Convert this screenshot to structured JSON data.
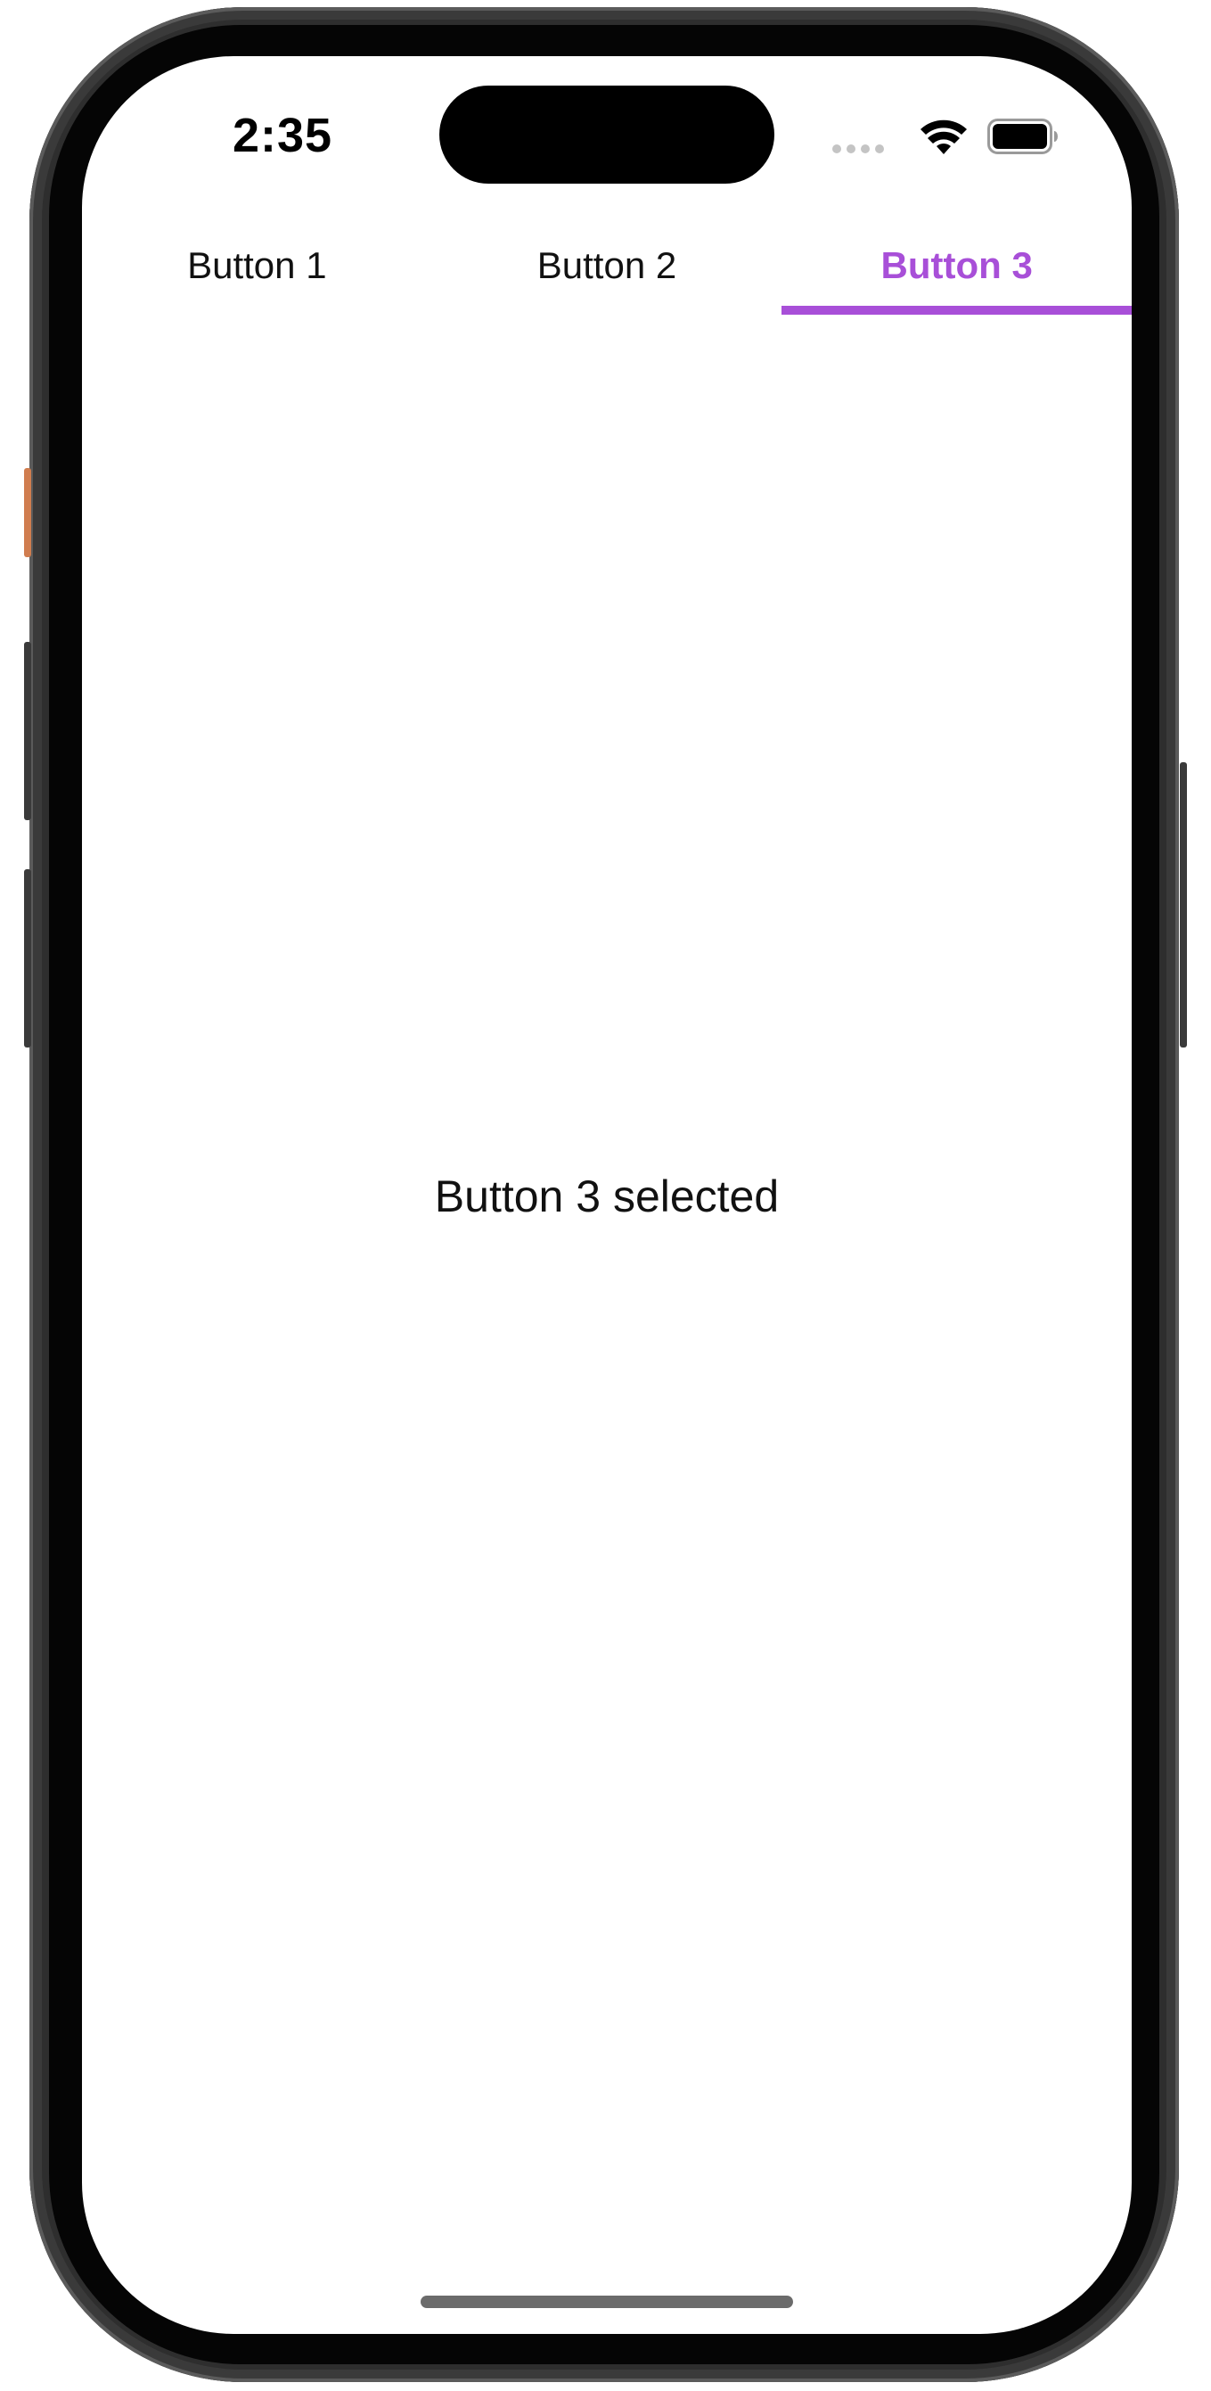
{
  "status_bar": {
    "time": "2:35",
    "icons": [
      "cellular-signal-icon",
      "wifi-icon",
      "battery-icon"
    ]
  },
  "tabs": [
    {
      "label": "Button 1",
      "selected": false
    },
    {
      "label": "Button 2",
      "selected": false
    },
    {
      "label": "Button 3",
      "selected": true
    }
  ],
  "content": {
    "message": "Button 3 selected"
  },
  "colors": {
    "accent": "#a84fd8",
    "text": "#111111",
    "background": "#ffffff"
  }
}
